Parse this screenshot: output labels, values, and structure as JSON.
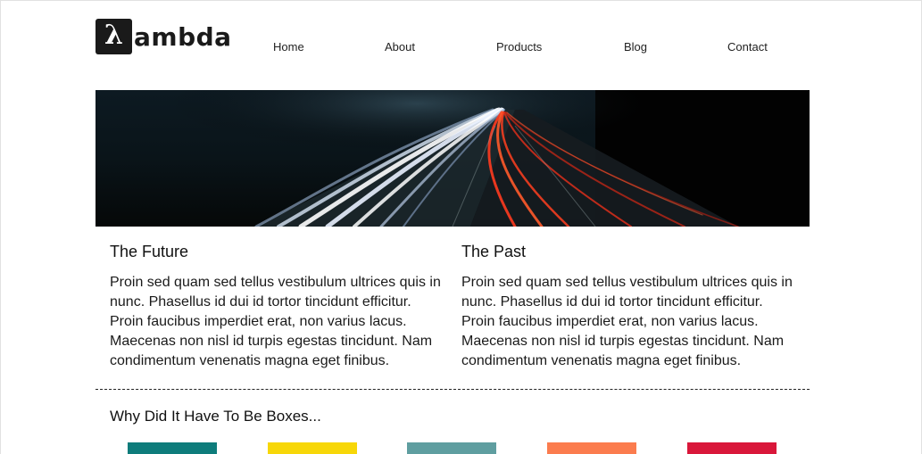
{
  "logo": {
    "mark": "λ",
    "text": "ambda"
  },
  "nav": {
    "items": [
      {
        "label": "Home"
      },
      {
        "label": "About"
      },
      {
        "label": "Products"
      },
      {
        "label": "Blog"
      },
      {
        "label": "Contact"
      }
    ]
  },
  "columns": [
    {
      "title": "The Future",
      "body": "Proin sed quam sed tellus vestibulum ultrices quis in nunc. Phasellus id dui id tortor tincidunt efficitur. Proin faucibus imperdiet erat, non varius lacus. Maecenas non nisl id turpis egestas tincidunt. Nam condimentum venenatis magna eget finibus."
    },
    {
      "title": "The Past",
      "body": "Proin sed quam sed tellus vestibulum ultrices quis in nunc. Phasellus id dui id tortor tincidunt efficitur. Proin faucibus imperdiet erat, non varius lacus. Maecenas non nisl id turpis egestas tincidunt. Nam condimentum venenatis magna eget finibus."
    }
  ],
  "boxes": {
    "heading": "Why Did It Have To Be Boxes...",
    "colors": [
      "#0e7c7b",
      "#f7d708",
      "#5f9ea0",
      "#fb7c4e",
      "#d9173a"
    ]
  }
}
